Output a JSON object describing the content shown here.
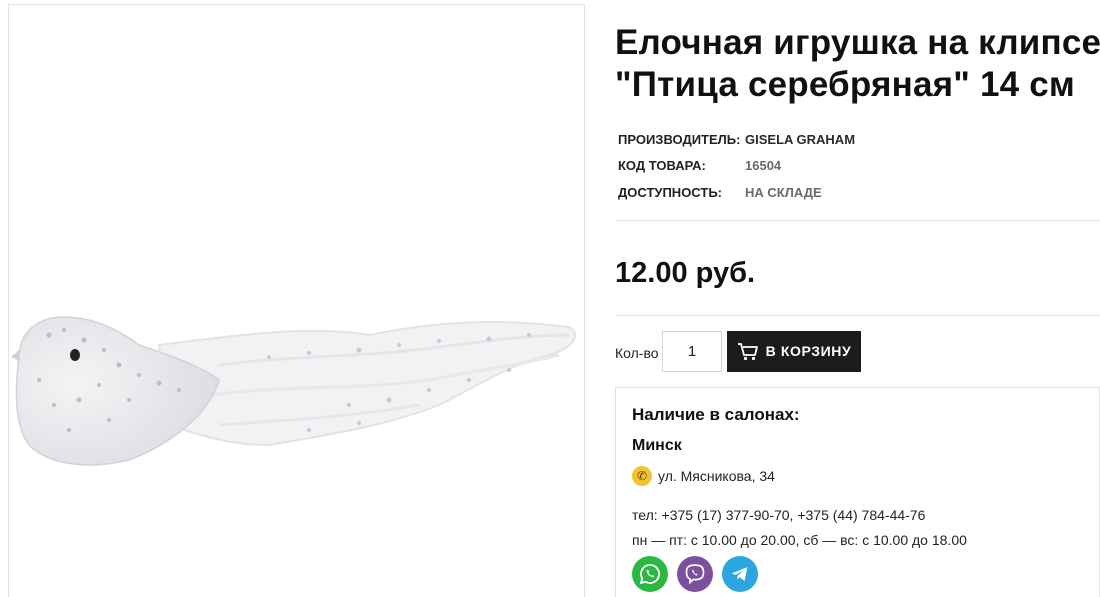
{
  "product": {
    "title_line1": "Елочная игрушка на клипсе",
    "title_line2": "\"Птица серебряная\" 14 см",
    "image_alt": "Птица серебряная",
    "properties": [
      {
        "label": "ПРОИЗВОДИТЕЛЬ:",
        "value": "GISELA GRAHAM"
      },
      {
        "label": "КОД ТОВАРА:",
        "value": "16504"
      },
      {
        "label": "ДОСТУПНОСТЬ:",
        "value": "НА СКЛАДЕ"
      }
    ],
    "price": "12.00 руб."
  },
  "buy": {
    "qty_label": "Кол-во",
    "qty_value": "1",
    "cart_button_label": "В КОРЗИНУ"
  },
  "salons": {
    "title": "Наличие в салонах:",
    "city": "Минск",
    "address": "ул. Мясникова, 34",
    "phones": "тел: +375 (17) 377-90-70, +375 (44) 784-44-76",
    "hours": "пн — пт: с 10.00 до 20.00, сб — вс: с 10.00 до 18.00",
    "messengers": [
      "whatsapp-icon",
      "viber-icon",
      "telegram-icon"
    ]
  },
  "colors": {
    "button_bg": "#1c1c1c",
    "whatsapp": "#2cb742",
    "viber": "#7b519d",
    "telegram": "#2ca5e0",
    "phone_badge": "#f2c230"
  }
}
